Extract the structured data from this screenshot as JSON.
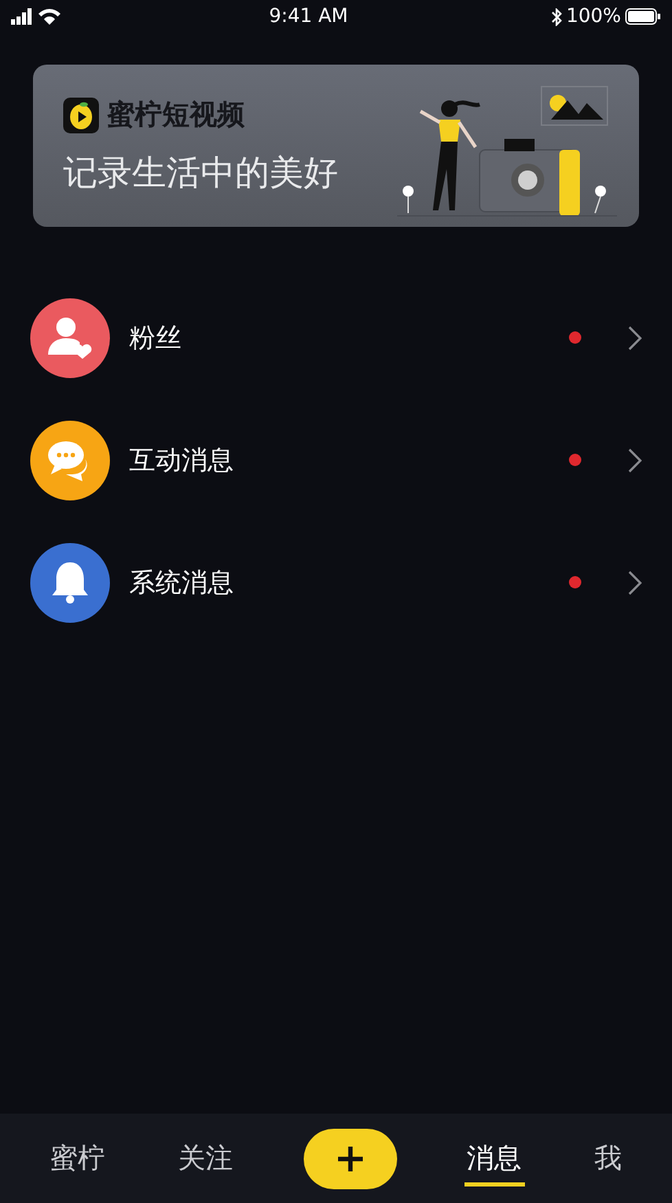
{
  "status_bar": {
    "time": "9:41 AM",
    "battery": "100%"
  },
  "banner": {
    "brand": "蜜柠短视频",
    "slogan": "记录生活中的美好"
  },
  "messages": [
    {
      "kind": "fans",
      "label": "粉丝",
      "unread": true
    },
    {
      "kind": "interaction",
      "label": "互动消息",
      "unread": true
    },
    {
      "kind": "system",
      "label": "系统消息",
      "unread": true
    }
  ],
  "tab_bar": [
    {
      "kind": "text",
      "label": "蜜柠",
      "selected": false
    },
    {
      "kind": "text",
      "label": "关注",
      "selected": false
    },
    {
      "kind": "add"
    },
    {
      "kind": "text",
      "label": "消息",
      "selected": true
    },
    {
      "kind": "text",
      "label": "我",
      "selected": false
    }
  ]
}
